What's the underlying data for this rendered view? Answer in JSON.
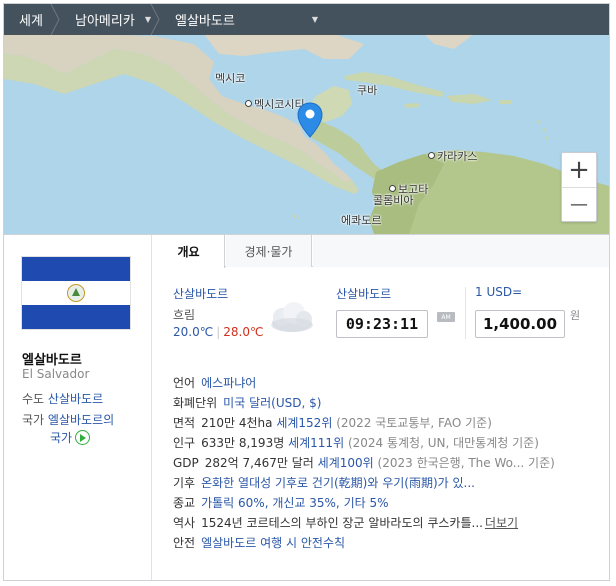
{
  "breadcrumb": [
    {
      "label": "세계",
      "dropdown": false
    },
    {
      "label": "남아메리카",
      "dropdown": true
    },
    {
      "label": "엘살바도르",
      "dropdown": true
    }
  ],
  "map": {
    "labels": {
      "mexico": "멕시코",
      "mexico_city": "멕시코시티",
      "cuba": "쿠바",
      "caracas": "카라카스",
      "bogota": "보고타",
      "colombia": "콜롬비아",
      "ecuador": "에콰도르"
    },
    "zoom_in": "+",
    "zoom_out": "—"
  },
  "country": {
    "name": "엘살바도르",
    "name_en": "El Salvador",
    "capital_label": "수도",
    "capital": "산살바도르",
    "anthem_label": "국가",
    "anthem_line1": "엘살바도르의",
    "anthem_line2": "국가"
  },
  "tabs": [
    {
      "label": "개요",
      "active": true
    },
    {
      "label": "경제·물가",
      "active": false
    }
  ],
  "weather": {
    "city": "산살바도르",
    "condition": "흐림",
    "low": "20.0℃",
    "high": "28.0℃",
    "icon": "cloud-icon"
  },
  "time": {
    "city": "산살바도르",
    "value": "09:23:11",
    "ampm": "AM"
  },
  "exchange": {
    "label": "1 USD=",
    "value": "1,400.00",
    "unit": "원"
  },
  "facts": {
    "language": {
      "k": "언어",
      "v": "에스파냐어"
    },
    "currency": {
      "k": "화폐단위",
      "v": "미국 달러(USD, $)"
    },
    "area": {
      "k": "면적",
      "v": "210만 4천ha",
      "rank": "세계152위",
      "src": "(2022 국토교통부, FAO 기준)"
    },
    "population": {
      "k": "인구",
      "v": "633만 8,193명",
      "rank": "세계111위",
      "src": "(2024 통계청, UN, 대만통계청 기준)"
    },
    "gdp": {
      "k": "GDP",
      "v": "282억 7,467만 달러",
      "rank": "세계100위",
      "src": "(2023 한국은행, The Wo...  기준)"
    },
    "climate": {
      "k": "기후",
      "v": "온화한 열대성 기후로 건기(乾期)와 우기(雨期)가 있..."
    },
    "religion": {
      "k": "종교",
      "v": "가톨릭 60%, 개신교 35%, 기타 5%"
    },
    "history": {
      "k": "역사",
      "v": "1524년 코르테스의 부하인 장군 알바라도의 쿠스카틀...",
      "more": "더보기"
    },
    "safety": {
      "k": "안전",
      "v": "엘살바도르 여행 시 안전수칙"
    }
  },
  "colors": {
    "link": "#2a57a8",
    "low_temp": "#2a57a8",
    "high_temp": "#d0301d",
    "pin": "#2d8be8",
    "flag_blue": "#1f4bb0"
  }
}
